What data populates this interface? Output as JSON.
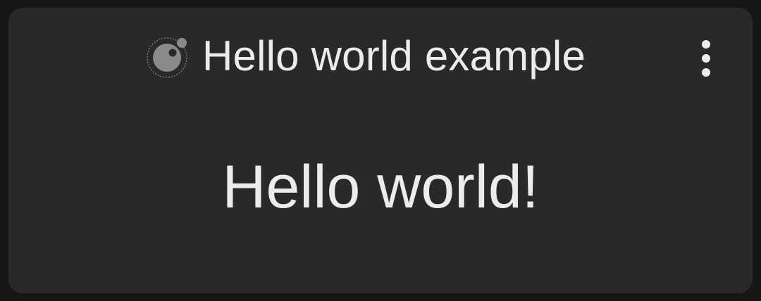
{
  "header": {
    "title": "Hello world example",
    "app_icon": "ionic-logo-icon",
    "menu_icon": "more-vertical-icon"
  },
  "main": {
    "message": "Hello world!"
  },
  "colors": {
    "background": "#161616",
    "card": "#292929",
    "text": "#ececec",
    "icon": "#8a8a8a"
  }
}
